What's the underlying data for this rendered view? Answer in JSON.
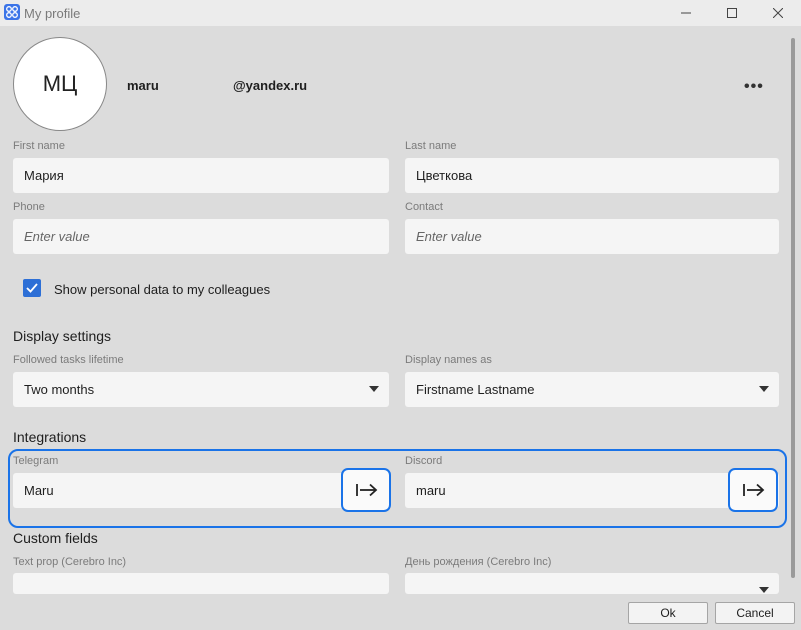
{
  "window": {
    "title": "My profile"
  },
  "profile": {
    "initials": "МЦ",
    "login": "maru",
    "email_domain": "@yandex.ru",
    "more_label": "•••"
  },
  "form": {
    "first_name": {
      "label": "First name",
      "value": "Мария"
    },
    "last_name": {
      "label": "Last name",
      "value": "Цветкова"
    },
    "phone": {
      "label": "Phone",
      "placeholder": "Enter value"
    },
    "contact": {
      "label": "Contact",
      "placeholder": "Enter value"
    },
    "show_personal": {
      "label": "Show personal data to my colleagues",
      "checked": true
    }
  },
  "display_settings": {
    "title": "Display settings",
    "followed_tasks": {
      "label": "Followed tasks lifetime",
      "value": "Two months"
    },
    "display_names": {
      "label": "Display names as",
      "value": "Firstname Lastname"
    }
  },
  "integrations": {
    "title": "Integrations",
    "telegram": {
      "label": "Telegram",
      "value": "Maru"
    },
    "discord": {
      "label": "Discord",
      "value": "maru"
    }
  },
  "custom_fields": {
    "title": "Custom fields",
    "text_prop": {
      "label": "Text prop (Cerebro Inc)",
      "value": ""
    },
    "birthday": {
      "label": "День рождения (Cerebro Inc)",
      "value": ""
    }
  },
  "footer": {
    "ok_label": "Ok",
    "cancel_label": "Cancel"
  },
  "colors": {
    "accent": "#1a73e8",
    "checkbox": "#2d6fd6",
    "background": "#dcdcdc",
    "field": "#f5f5f5"
  },
  "icons": {
    "app": "app-logo-icon",
    "minimize": "minimize-icon",
    "maximize": "maximize-icon",
    "close": "close-icon",
    "more": "more-options-icon",
    "check": "checkmark-icon",
    "dropdown": "chevron-down-icon",
    "go": "arrow-right-to-bar-icon"
  }
}
